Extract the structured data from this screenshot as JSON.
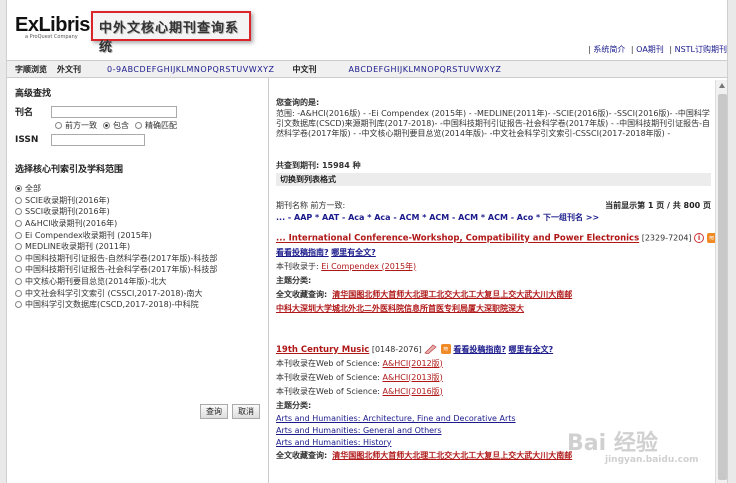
{
  "header": {
    "logo_brand_a": "ExLibris",
    "logo_tagline": "a ProQuest Company",
    "system_title": "中外文核心期刊查询系统",
    "links": [
      "系统简介",
      "OA期刊",
      "NSTL订购期刊"
    ]
  },
  "alphabar": {
    "browse_label": "字顺浏览",
    "foreign_label": "外文刊",
    "foreign_letters": [
      "0-9",
      "A",
      "B",
      "C",
      "D",
      "E",
      "F",
      "G",
      "H",
      "I",
      "J",
      "K",
      "L",
      "M",
      "N",
      "O",
      "P",
      "Q",
      "R",
      "S",
      "T",
      "U",
      "V",
      "W",
      "X",
      "Y",
      "Z"
    ],
    "chinese_label": "中文刊",
    "chinese_letters": [
      "A",
      "B",
      "C",
      "D",
      "E",
      "F",
      "G",
      "H",
      "I",
      "J",
      "K",
      "L",
      "M",
      "N",
      "O",
      "P",
      "Q",
      "R",
      "S",
      "T",
      "U",
      "V",
      "W",
      "X",
      "Y",
      "Z"
    ]
  },
  "search": {
    "heading": "高级查找",
    "title_label": "刊名",
    "match_options": [
      "前方一致",
      "包含",
      "精确匹配"
    ],
    "match_selected": "包含",
    "issn_label": "ISSN",
    "scope_heading": "选择核心刊索引及学科范围",
    "categories": [
      "全部",
      "SCIE收录期刊(2016年)",
      "SSCI收录期刊(2016年)",
      "A&HCI收录期刊(2016年)",
      "Ei Compendex收录期刊 (2015年)",
      "MEDLINE收录期刊 (2011年)",
      "中国科技期刊引证报告-自然科学卷(2017年版)-科技部",
      "中国科技期刊引证报告-社会科学卷(2017年版)-科技部",
      "中文核心期刊要目总览(2014年版)-北大",
      "中文社会科学引文索引 (CSSCI,2017-2018)-南大",
      "中国科学引文数据库(CSCD,2017-2018)-中科院"
    ],
    "category_selected": "全部",
    "search_button": "查询",
    "cancel_button": "取消"
  },
  "results": {
    "query_label": "您查询的是:",
    "scope_text": "范围:    -A&HCI(2016版) -    -Ei Compendex (2015年) -    -MEDLINE(2011年)-    -SCIE(2016版)-    -SSCI(2016版)-    -中国科学引文数据库(CSCD)来源期刊库(2017-2018)-    -中国科技期刊引证报告-社会科学卷(2017年版) -    -中国科技期刊引证报告-自然科学卷(2017年版) -    -中文核心期刊要目总览(2014年版)-    -中文社会科学引文索引-CSSCI(2017-2018年版) -",
    "total_text": "共查到期刊: 15984 种",
    "switch_list": "切换到列表格式",
    "pager_left": "期刊名称 前方一致:",
    "pager_right": "当前显示第 1 页 / 共 800 页",
    "nav_text": "... - AAP * AAT - Aca * Aca - ACM * ACM - ACM * ACM - Aco * 下一组刊名 >>",
    "records": [
      {
        "title": "... International Conference-Workshop, Compatibility and Power Electronics",
        "issn": "[2329-7204]",
        "guide_link": "看看投稿指南?",
        "fulltext_link": "哪里有全文?",
        "indexed_label": "本刊收录于:",
        "indexed_items": [
          "Ei Compendex (2015年)"
        ],
        "subject_label": "主题分类:",
        "subjects": [],
        "holdings_label": "全文收藏查询:",
        "holdings_line1": [
          "清华",
          "国图",
          "北师大",
          "首师大",
          "北理工",
          "北交大",
          "北工大",
          "复旦",
          "上交大",
          "武大",
          "川大",
          "南邮"
        ],
        "holdings_line2": [
          "中科大",
          "深圳大学城",
          "北外",
          "北二外",
          "医科院信息所",
          "首医",
          "专利局",
          "厦大",
          "深职院",
          "深大"
        ]
      },
      {
        "title": "19th Century Music",
        "issn": "[0148-2076]",
        "guide_link": "看看投稿指南?",
        "fulltext_link": "哪里有全文?",
        "indexed_label": "本刊收录在Web of Science:",
        "indexed_items": [
          "A&HCI(2012版)",
          "A&HCI(2013版)",
          "A&HCI(2016版)"
        ],
        "subject_label": "主题分类:",
        "subjects": [
          "Arts and Humanities: Architecture, Fine and Decorative Arts",
          "Arts and Humanities: General and Others",
          "Arts and Humanities: History"
        ],
        "holdings_label": "全文收藏查询:",
        "holdings_line1": [
          "清华",
          "国图",
          "北师大",
          "首师大",
          "北理工",
          "北交大",
          "北工大",
          "复旦",
          "上交大",
          "武大",
          "川大",
          "南邮"
        ],
        "holdings_line2": []
      }
    ]
  },
  "watermark": {
    "main": "Bai 经验",
    "sub": "jingyan.baidu.com"
  },
  "colors": {
    "accent_red": "#b01818",
    "link_blue": "#1a1a8c",
    "title_border": "#d9262a",
    "rss_orange": "#f08a24"
  }
}
